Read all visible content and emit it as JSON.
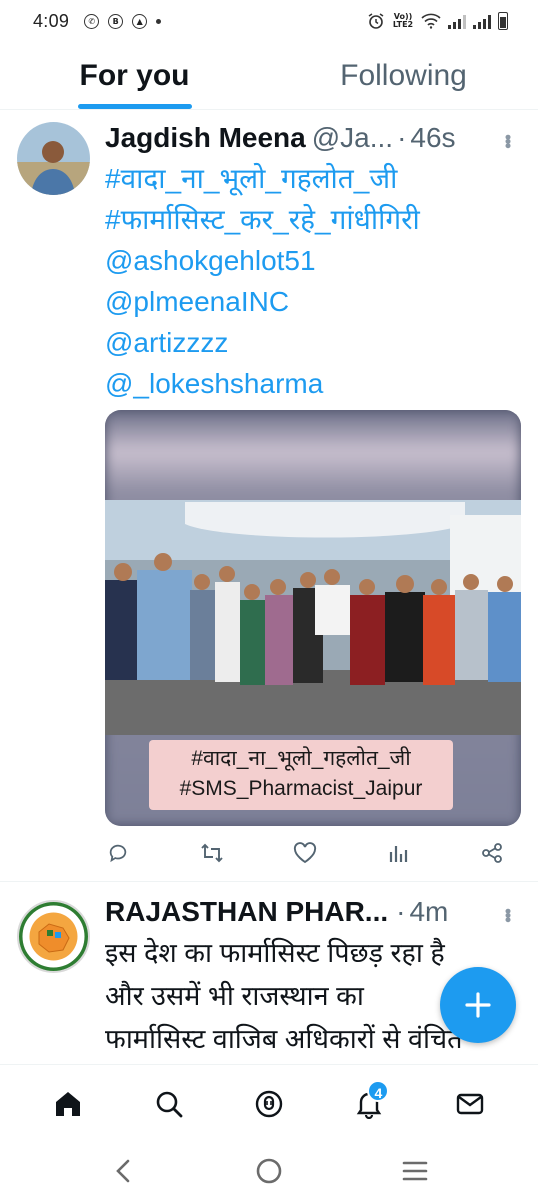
{
  "status_bar": {
    "time": "4:09",
    "network_label": "Vo)) LTE2"
  },
  "tabs": [
    {
      "label": "For you",
      "active": true
    },
    {
      "label": "Following",
      "active": false
    }
  ],
  "tweets": [
    {
      "author": "Jagdish Meena",
      "handle": "@Ja...",
      "separator": "·",
      "time": "46s",
      "lines": [
        "#वादा_ना_भूलो_गहलोत_जी",
        "#फार्मासिस्ट_कर_रहे_गांधीगिरी",
        "@ashokgehlot51",
        "@plmeenaINC",
        "@artizzzz",
        "@_lokeshsharma"
      ],
      "media_caption_line1": "#वादा_ना_भूलो_गहलोत_जी",
      "media_caption_line2": "#SMS_Pharmacist_Jaipur"
    },
    {
      "author": "RAJASTHAN PHAR...",
      "separator": "·",
      "time": "4m",
      "lines": [
        "इस देश का फार्मासिस्ट पिछड़ रहा है",
        "और उसमें भी राजस्थान का",
        "फार्मासिस्ट वाजिब अधिकारों से वंचित"
      ]
    }
  ],
  "bottom_nav": {
    "notifications_badge": "4"
  },
  "colors": {
    "accent": "#1d9bf0",
    "text_primary": "#0f1419",
    "text_secondary": "#536471"
  },
  "icons": [
    "home-icon",
    "search-icon",
    "spaces-icon",
    "notifications-icon",
    "messages-icon",
    "reply-icon",
    "retweet-icon",
    "like-icon",
    "views-icon",
    "share-icon",
    "compose-icon",
    "back-icon",
    "home-circle-icon",
    "recents-icon"
  ]
}
